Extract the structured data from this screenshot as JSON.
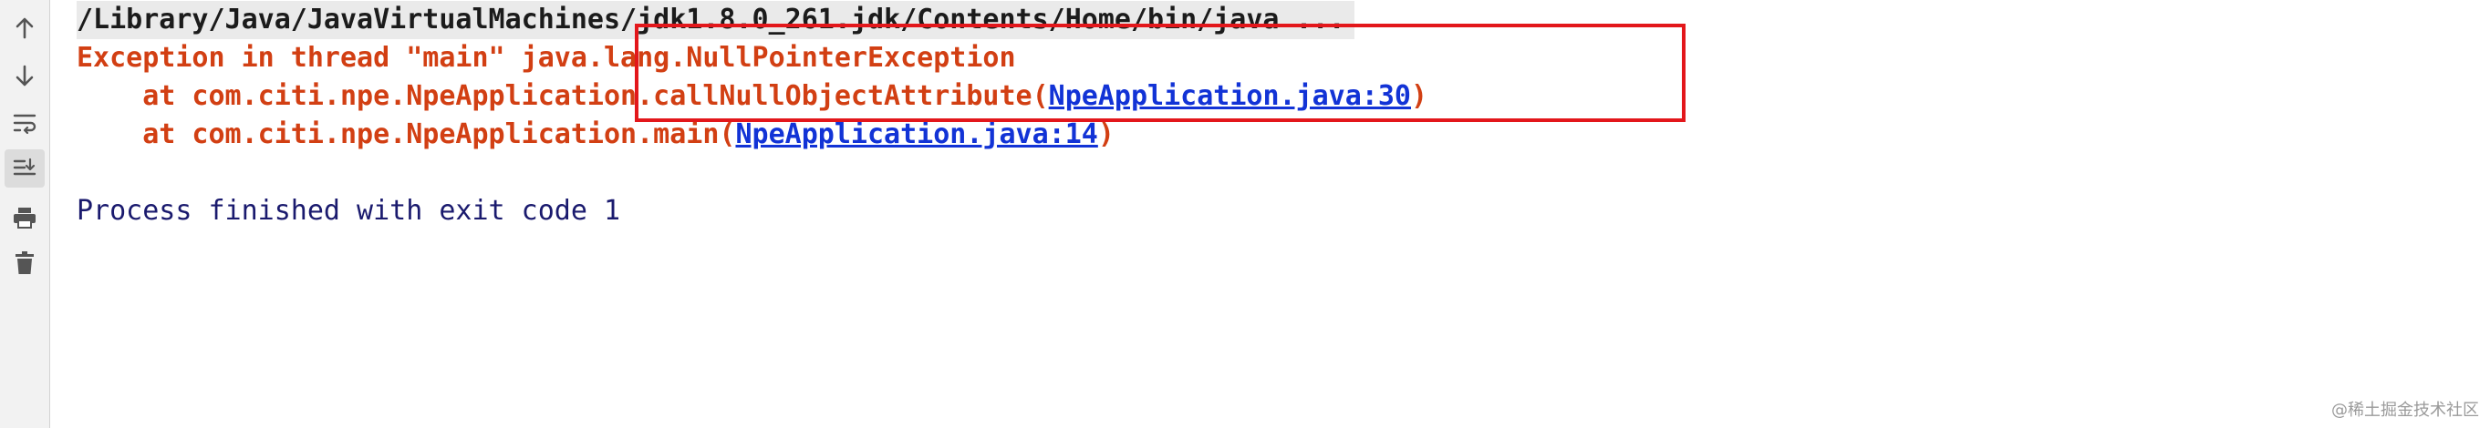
{
  "toolbar": {
    "items": [
      {
        "name": "up-arrow-icon"
      },
      {
        "name": "down-arrow-icon"
      },
      {
        "name": "soft-wrap-icon"
      },
      {
        "name": "scroll-to-end-icon",
        "active": true
      },
      {
        "name": "print-icon"
      },
      {
        "name": "trash-icon"
      }
    ]
  },
  "console": {
    "command": "/Library/Java/JavaVirtualMachines/jdk1.8.0_261.jdk/Contents/Home/bin/java ...",
    "exception_prefix": "Exception in thread \"main\" ",
    "exception_class": "java.lang.NullPointerException",
    "stack": [
      {
        "prefix": "    at com.citi.npe.NpeApplication.callNullObjectAttribute(",
        "link": "NpeApplication.java:30",
        "suffix": ")"
      },
      {
        "prefix": "    at com.citi.npe.NpeApplication.main(",
        "link": "NpeApplication.java:14",
        "suffix": ")"
      }
    ],
    "exit_message": "Process finished with exit code 1"
  },
  "watermark": "@稀土掘金技术社区",
  "colors": {
    "error": "#d23f13",
    "link": "#1233d6",
    "normal": "#1a1a6e",
    "highlight": "#e3171b"
  }
}
